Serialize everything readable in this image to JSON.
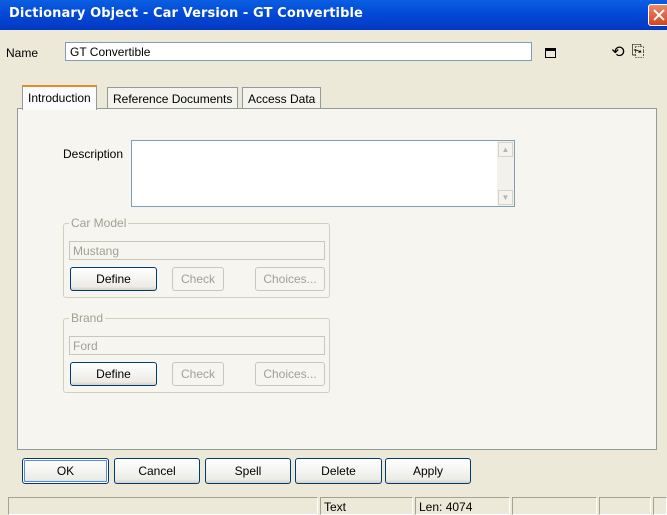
{
  "window": {
    "title": "Dictionary Object - Car Version - GT Convertible"
  },
  "name_row": {
    "label": "Name",
    "value": "GT Convertible"
  },
  "icons": {
    "close": "close-icon",
    "maximize": "maximize-icon",
    "refresh": "refresh-icon",
    "export": "export-icon"
  },
  "tabs": [
    {
      "label": "Introduction",
      "active": true
    },
    {
      "label": "Reference Documents",
      "active": false
    },
    {
      "label": "Access Data",
      "active": false
    }
  ],
  "description": {
    "label": "Description",
    "value": ""
  },
  "car_model": {
    "legend": "Car Model",
    "value": "Mustang",
    "define_label": "Define",
    "check_label": "Check",
    "choices_label": "Choices..."
  },
  "brand": {
    "legend": "Brand",
    "value": "Ford",
    "define_label": "Define",
    "check_label": "Check",
    "choices_label": "Choices..."
  },
  "buttons": {
    "ok": "OK",
    "cancel": "Cancel",
    "spell": "Spell",
    "delete": "Delete",
    "apply": "Apply"
  },
  "status": {
    "mode": "Text",
    "length": "Len: 4074"
  },
  "colors": {
    "titlebar": "#0349d8",
    "accent_tab": "#e68b2c",
    "window_bg": "#ece9d8"
  }
}
